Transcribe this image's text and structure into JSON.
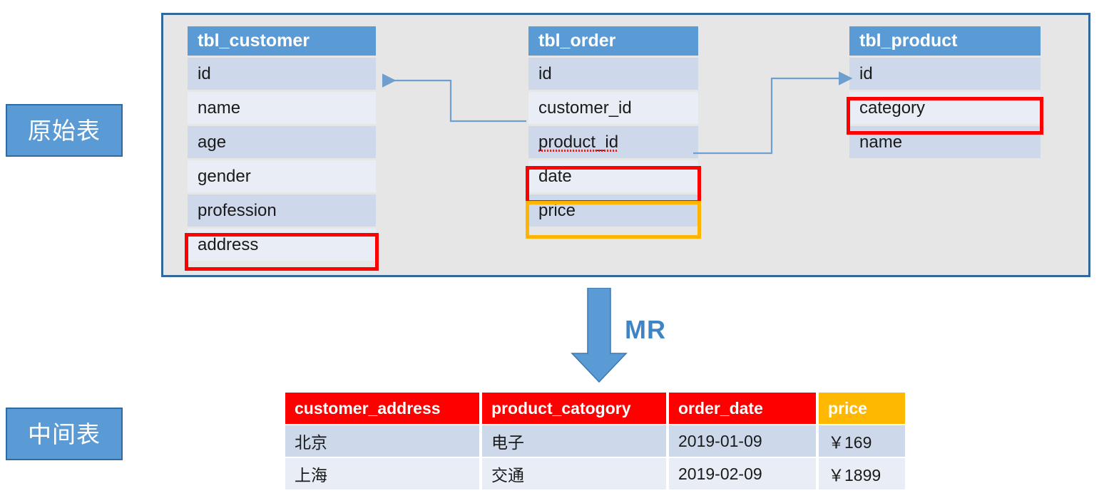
{
  "stages": {
    "source_label": "原始表",
    "intermediate_label": "中间表"
  },
  "source_tables": [
    {
      "name": "tbl_customer",
      "columns": [
        {
          "label": "id",
          "highlight": null
        },
        {
          "label": "name",
          "highlight": null
        },
        {
          "label": "age",
          "highlight": null
        },
        {
          "label": "gender",
          "highlight": null
        },
        {
          "label": "profession",
          "highlight": null
        },
        {
          "label": "address",
          "highlight": "red"
        }
      ]
    },
    {
      "name": "tbl_order",
      "columns": [
        {
          "label": "id",
          "highlight": null
        },
        {
          "label": "customer_id",
          "highlight": null
        },
        {
          "label": "product_id",
          "highlight": null,
          "misspelled": true
        },
        {
          "label": "date",
          "highlight": "red"
        },
        {
          "label": "price",
          "highlight": "orange"
        }
      ]
    },
    {
      "name": "tbl_product",
      "columns": [
        {
          "label": "id",
          "highlight": null
        },
        {
          "label": "category",
          "highlight": "red"
        },
        {
          "label": "name",
          "highlight": null
        }
      ]
    }
  ],
  "transform": {
    "label": "MR",
    "arrow_color": "#5b9bd5",
    "label_color": "#3f84c4"
  },
  "result_table": {
    "headers": [
      {
        "label": "customer_address",
        "color": "#ff0000"
      },
      {
        "label": "product_catogory",
        "color": "#ff0000"
      },
      {
        "label": "order_date",
        "color": "#ff0000"
      },
      {
        "label": "price",
        "color": "#ffb800"
      }
    ],
    "rows": [
      [
        "北京",
        "电子",
        "2019-01-09",
        "￥169"
      ],
      [
        "上海",
        "交通",
        "2019-02-09",
        "￥1899"
      ]
    ]
  },
  "colors": {
    "table_header_blue": "#5b9bd5",
    "row_dark": "#cdd8ea",
    "row_light": "#e8edf6",
    "container_bg": "#e6e6e6",
    "container_border": "#336699",
    "highlight_red": "#ff0000",
    "highlight_orange": "#ffb400",
    "connector_blue": "#6f9fce"
  }
}
